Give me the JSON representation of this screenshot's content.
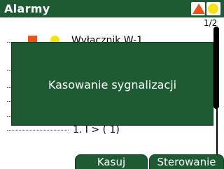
{
  "header": {
    "title": "Alarmy",
    "alarm_red_color": "#e8541a",
    "alarm_yellow_color": "#f3e315"
  },
  "pager": {
    "text": "1/2"
  },
  "list": {
    "top_row_text": "Wyłacznik W-1",
    "bottom_row_text": "1. I > ( 1)"
  },
  "dialog": {
    "message": "Kasowanie sygnalizacji"
  },
  "softkeys": {
    "left_label": "Kasuj",
    "right_label": "Sterowanie"
  },
  "colors": {
    "brand_green": "#1e5a32",
    "text": "#000000",
    "inverse_text": "#ffffff"
  }
}
